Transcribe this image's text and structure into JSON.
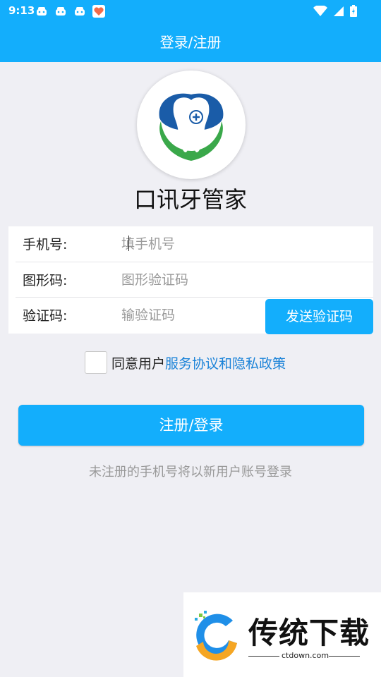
{
  "status": {
    "time": "9:13"
  },
  "header": {
    "title": "登录/注册"
  },
  "app": {
    "name": "口讯牙管家"
  },
  "form": {
    "phone": {
      "label": "手机号:",
      "placeholder": "填手机号"
    },
    "captcha": {
      "label": "图形码:",
      "placeholder": "图形验证码"
    },
    "sms": {
      "label": "验证码:",
      "placeholder": "输验证码",
      "send_label": "发送验证码"
    }
  },
  "agreement": {
    "prefix": "同意用户",
    "link": "服务协议和隐私政策",
    "checked": false
  },
  "submit_label": "注册/登录",
  "hint": "未注册的手机号将以新用户账号登录",
  "watermark": {
    "title": "传统下载",
    "url": "ctdown.com"
  },
  "colors": {
    "accent": "#13aefc",
    "link": "#1b83d8",
    "logo_blue": "#1a5ca8",
    "logo_green": "#3aa84a"
  }
}
